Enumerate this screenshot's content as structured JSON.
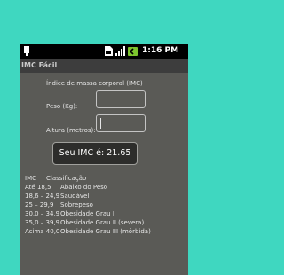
{
  "status_bar": {
    "time": "1:16 PM"
  },
  "app": {
    "title": "IMC Fácil"
  },
  "form": {
    "heading": "Índice de massa corporal (IMC)",
    "peso_label": "Peso (Kg):",
    "peso_value": "",
    "altura_label": "Altura (metros):",
    "altura_value": ""
  },
  "toast": {
    "text": "Seu IMC é: 21.65"
  },
  "table": {
    "headers": [
      "IMC",
      "Classificação"
    ],
    "rows": [
      [
        "Até 18,5",
        "Abaixo do Peso"
      ],
      [
        "18,6 – 24,9",
        "Saudável"
      ],
      [
        "25 – 29,9",
        "Sobrepeso"
      ],
      [
        "30,0 – 34,9",
        "Obesidade Grau I"
      ],
      [
        "35,0 – 39,9",
        "Obesidade Grau II (severa)"
      ],
      [
        "Acima 40,0",
        "Obesidade Grau III (mórbida)"
      ]
    ]
  },
  "colors": {
    "background": "#3fd7c0",
    "screen": "#5a5a56",
    "status_bar": "#000000",
    "title_bar": "#3d3d3d",
    "battery": "#7dc52e"
  }
}
